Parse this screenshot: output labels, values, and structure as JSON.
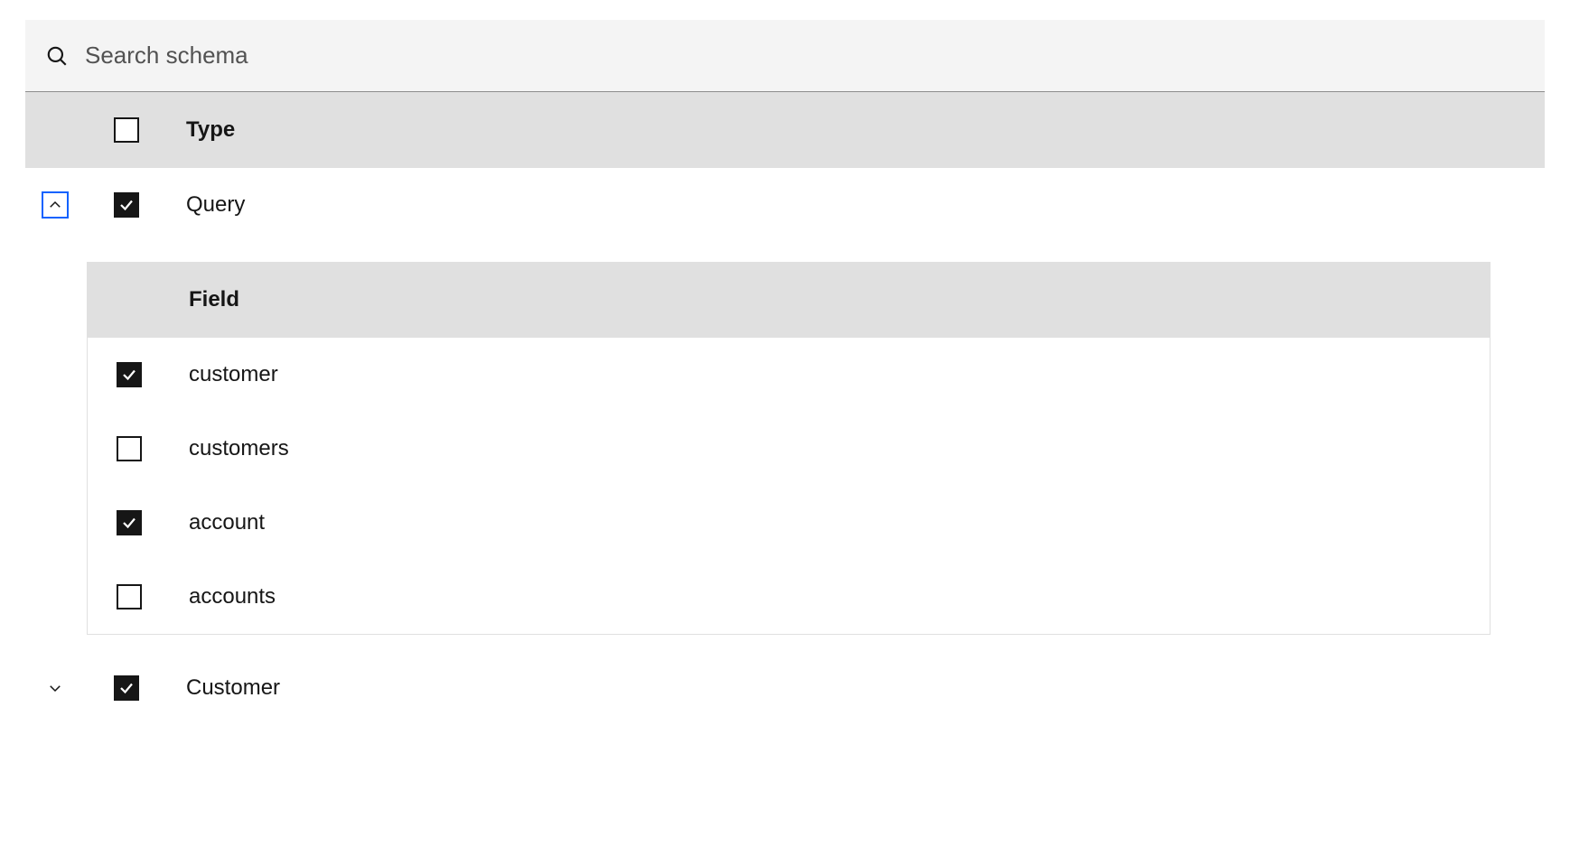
{
  "search": {
    "placeholder": "Search schema",
    "value": ""
  },
  "typeHeader": "Type",
  "fieldHeader": "Field",
  "types": [
    {
      "label": "Query",
      "checked": true,
      "expanded": true,
      "focused": true,
      "fields": [
        {
          "label": "customer",
          "checked": true
        },
        {
          "label": "customers",
          "checked": false
        },
        {
          "label": "account",
          "checked": true
        },
        {
          "label": "accounts",
          "checked": false
        }
      ]
    },
    {
      "label": "Customer",
      "checked": true,
      "expanded": false,
      "focused": false
    }
  ]
}
